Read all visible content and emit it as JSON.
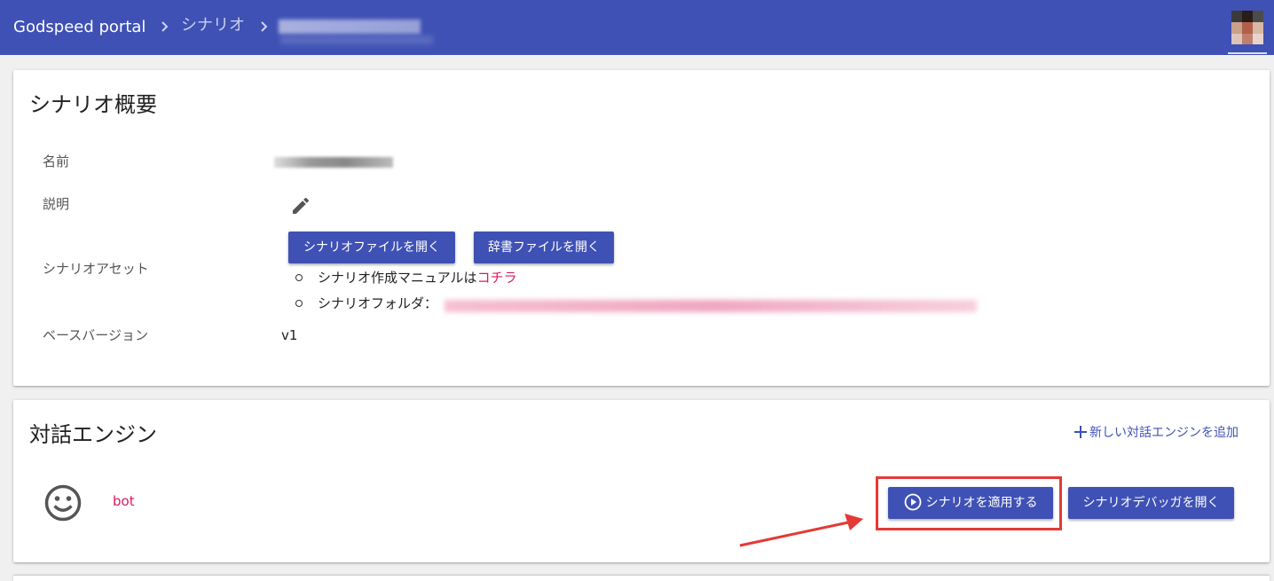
{
  "header": {
    "brand": "Godspeed portal",
    "breadcrumb": [
      "シナリオ"
    ],
    "bar_color": "#3f51b5"
  },
  "overview": {
    "title": "シナリオ概要",
    "rows": {
      "name_label": "名前",
      "description_label": "説明",
      "assets_label": "シナリオアセット",
      "base_version_label": "ベースバージョン",
      "base_version_value": "v1"
    },
    "buttons": {
      "open_scenario_file": "シナリオファイルを開く",
      "open_dictionary_file": "辞書ファイルを開く"
    },
    "links": {
      "manual_prefix": "シナリオ作成マニュアルは",
      "manual_link": "コチラ",
      "folder_prefix": "シナリオフォルダ："
    }
  },
  "engines": {
    "title": "対話エンジン",
    "add_link": "新しい対話エンジンを追加",
    "items": [
      {
        "name": "bot",
        "icon": "smiley-face-icon",
        "apply_button": "シナリオを適用する",
        "debugger_button": "シナリオデバッガを開く"
      }
    ]
  },
  "colors": {
    "primary": "#3f51b5",
    "accent": "#d81b60",
    "annotation": "#e53935"
  }
}
